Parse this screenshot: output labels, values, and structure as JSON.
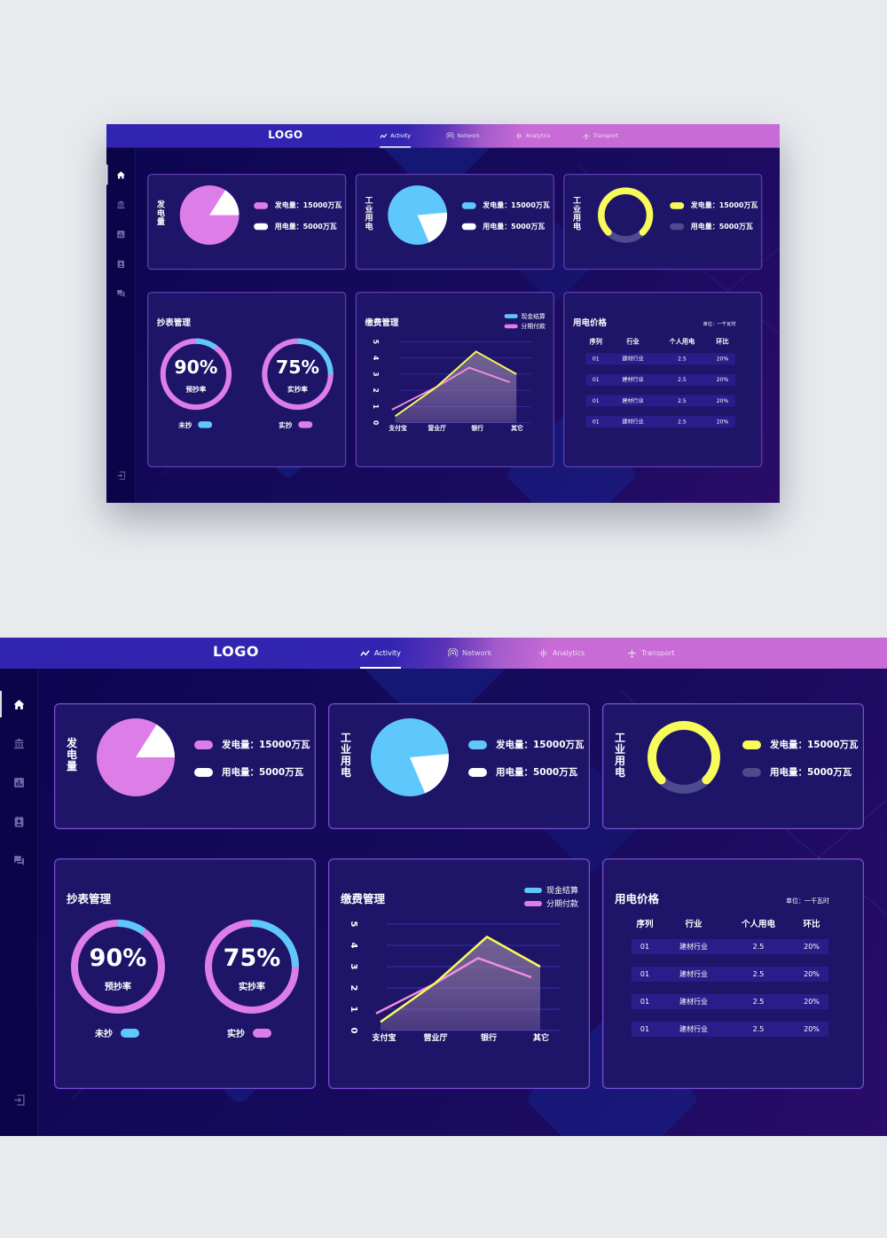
{
  "header": {
    "logo": "LOGO",
    "tabs": [
      {
        "label": "Activity",
        "icon": "activity-icon",
        "active": true
      },
      {
        "label": "Network",
        "icon": "network-icon",
        "active": false
      },
      {
        "label": "Analytics",
        "icon": "analytics-icon",
        "active": false
      },
      {
        "label": "Transport",
        "icon": "airplane-icon",
        "active": false
      }
    ]
  },
  "sidebar": {
    "items": [
      {
        "name": "home",
        "icon": "home-icon",
        "active": true
      },
      {
        "name": "bank",
        "icon": "bank-icon",
        "active": false
      },
      {
        "name": "reports",
        "icon": "bar-chart-icon",
        "active": false
      },
      {
        "name": "contacts",
        "icon": "contact-card-icon",
        "active": false
      },
      {
        "name": "messages",
        "icon": "chat-icon",
        "active": false
      }
    ],
    "logout_icon": "logout-icon"
  },
  "colors": {
    "pink": "#dd7de8",
    "blue": "#5ec8fc",
    "yellow": "#f8fc5a",
    "white": "#ffffff",
    "muted": "#4e4a8e",
    "card_bg": "#1e1468",
    "header_start": "#3124b0",
    "header_end": "#c86bd6"
  },
  "cards": {
    "gen": {
      "title": "发电量",
      "legend": [
        {
          "label": "发电量：15000万瓦",
          "color": "#dd7de8"
        },
        {
          "label": "用电量：5000万瓦",
          "color": "#ffffff"
        }
      ]
    },
    "industry1": {
      "title": "工业用电",
      "legend": [
        {
          "label": "发电量：15000万瓦",
          "color": "#5ec8fc"
        },
        {
          "label": "用电量：5000万瓦",
          "color": "#ffffff"
        }
      ]
    },
    "industry2": {
      "title": "工业用电",
      "legend": [
        {
          "label": "发电量：15000万瓦",
          "color": "#f8fc5a"
        },
        {
          "label": "用电量：5000万瓦",
          "color": "#4e4a8e"
        }
      ]
    },
    "meter": {
      "title": "抄表管理",
      "gauges": [
        {
          "value": "90%",
          "label": "预抄率",
          "percent": 90,
          "legend": "未抄",
          "legend_color": "#5ec8fc"
        },
        {
          "value": "75%",
          "label": "实抄率",
          "percent": 75,
          "legend": "实抄",
          "legend_color": "#dd7de8"
        }
      ]
    },
    "payment": {
      "title": "缴费管理",
      "legend": [
        {
          "label": "现金结算",
          "color": "#5ec8fc"
        },
        {
          "label": "分期付款",
          "color": "#dd7de8"
        }
      ]
    },
    "price": {
      "title": "用电价格",
      "unit": "单位：一千瓦时",
      "columns": [
        "序列",
        "行业",
        "个人用电",
        "环比"
      ],
      "rows": [
        [
          "01",
          "建材行业",
          "2.5",
          "20%"
        ],
        [
          "01",
          "建材行业",
          "2.5",
          "20%"
        ],
        [
          "01",
          "建材行业",
          "2.5",
          "20%"
        ],
        [
          "01",
          "建材行业",
          "2.5",
          "20%"
        ]
      ]
    }
  },
  "chart_data": [
    {
      "type": "pie",
      "title": "发电量",
      "labels": [
        "发电量",
        "用电量"
      ],
      "values": [
        15000,
        5000
      ],
      "displayed_share": [
        0.84,
        0.16
      ],
      "colors": [
        "#dd7de8",
        "#ffffff"
      ]
    },
    {
      "type": "pie",
      "title": "工业用电",
      "labels": [
        "发电量",
        "用电量"
      ],
      "values": [
        15000,
        5000
      ],
      "displayed_share": [
        0.8,
        0.2
      ],
      "colors": [
        "#5ec8fc",
        "#ffffff"
      ]
    },
    {
      "type": "pie",
      "title": "工业用电",
      "labels": [
        "发电量",
        "用电量"
      ],
      "values": [
        15000,
        5000
      ],
      "displayed_share": [
        0.75,
        0.25
      ],
      "colors": [
        "#f8fc5a",
        "#4e4a8e"
      ]
    },
    {
      "type": "line",
      "title": "缴费管理",
      "categories": [
        "支付宝",
        "营业厅",
        "银行",
        "其它"
      ],
      "series": [
        {
          "name": "现金结算",
          "color": "#f8fc5a",
          "values": [
            0.4,
            2.2,
            4.4,
            3.0
          ]
        },
        {
          "name": "分期付款",
          "color": "#dd7de8",
          "values": [
            0.8,
            2.2,
            3.4,
            2.5
          ]
        }
      ],
      "yticks": [
        "0",
        "1",
        "2",
        "3",
        "4",
        "5"
      ],
      "ylim": [
        0,
        5
      ],
      "grid": true,
      "legend": "top-right"
    }
  ]
}
